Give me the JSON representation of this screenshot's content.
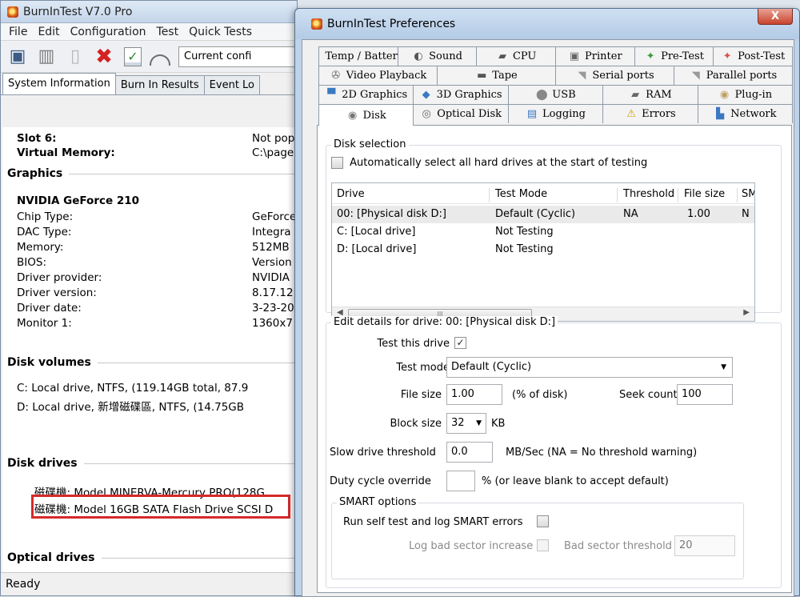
{
  "main": {
    "title": "BurnInTest V7.0 Pro",
    "menu": [
      "File",
      "Edit",
      "Configuration",
      "Test",
      "Quick Tests"
    ],
    "config_text": "Current confi",
    "tabs": [
      "System Information",
      "Burn In Results",
      "Event Lo"
    ],
    "status": "Ready",
    "info": {
      "slot6_label": "Slot 6:",
      "slot6_value": "Not pop",
      "vmem_label": "Virtual Memory:",
      "vmem_value": "C:\\page",
      "graphics_heading": "Graphics",
      "gpu_name": "NVIDIA GeForce 210",
      "graphics_rows": [
        {
          "label": "Chip Type:",
          "value": "GeForce"
        },
        {
          "label": "DAC Type:",
          "value": "Integra"
        },
        {
          "label": "Memory:",
          "value": "512MB"
        },
        {
          "label": "BIOS:",
          "value": "Version"
        },
        {
          "label": "Driver provider:",
          "value": "NVIDIA"
        },
        {
          "label": "Driver version:",
          "value": "8.17.12"
        },
        {
          "label": "Driver date:",
          "value": "3-23-20"
        },
        {
          "label": "Monitor 1:",
          "value": "1360x7"
        }
      ],
      "volumes_heading": "Disk volumes",
      "volumes": [
        "C:  Local drive, NTFS, (119.14GB total, 87.9",
        "D:  Local drive, 新增磁碟區, NTFS, (14.75GB"
      ],
      "drives_heading": "Disk drives",
      "drives": [
        "磁碟機: Model MINERVA-Mercury PRO(128G",
        "磁碟機: Model 16GB SATA Flash Drive SCSI D"
      ],
      "optical_heading": "Optical drives"
    }
  },
  "prefs": {
    "title": "BurnInTest Preferences",
    "close_label": "X",
    "tab_rows": [
      [
        {
          "label": "Temp / Battery",
          "icon": "thermometer-icon",
          "glyph": "▌",
          "color": "#d9534f"
        },
        {
          "label": "Sound",
          "icon": "speaker-icon",
          "glyph": "◐",
          "color": "#555555"
        },
        {
          "label": "CPU",
          "icon": "cpu-icon",
          "glyph": "▰",
          "color": "#555555"
        },
        {
          "label": "Printer",
          "icon": "printer-icon",
          "glyph": "▣",
          "color": "#666666"
        },
        {
          "label": "Pre-Test",
          "icon": "pretest-icon",
          "glyph": "✦",
          "color": "#3e9a3e"
        },
        {
          "label": "Post-Test",
          "icon": "posttest-icon",
          "glyph": "✦",
          "color": "#d9534f"
        }
      ],
      [
        {
          "label": "Video Playback",
          "icon": "video-icon",
          "glyph": "✇",
          "color": "#666666"
        },
        {
          "label": "Tape",
          "icon": "tape-icon",
          "glyph": "▬",
          "color": "#555555"
        },
        {
          "label": "Serial ports",
          "icon": "serial-port-icon",
          "glyph": "◥",
          "color": "#999999"
        },
        {
          "label": "Parallel ports",
          "icon": "parallel-port-icon",
          "glyph": "◥",
          "color": "#999999"
        }
      ],
      [
        {
          "label": "2D Graphics",
          "icon": "monitor-icon",
          "glyph": "▀",
          "color": "#3a78c2"
        },
        {
          "label": "3D Graphics",
          "icon": "cube-icon",
          "glyph": "◆",
          "color": "#3a78c2"
        },
        {
          "label": "USB",
          "icon": "usb-icon",
          "glyph": "⬤",
          "color": "#888888"
        },
        {
          "label": "RAM",
          "icon": "ram-icon",
          "glyph": "▰",
          "color": "#666666"
        },
        {
          "label": "Plug-in",
          "icon": "plugin-icon",
          "glyph": "◉",
          "color": "#c0a060"
        }
      ],
      [
        {
          "label": "Disk",
          "icon": "disk-icon",
          "glyph": "◉",
          "color": "#777777",
          "active": true
        },
        {
          "label": "Optical Disk",
          "icon": "optical-disk-icon",
          "glyph": "◎",
          "color": "#666666"
        },
        {
          "label": "Logging",
          "icon": "logging-icon",
          "glyph": "▤",
          "color": "#3a78c2"
        },
        {
          "label": "Errors",
          "icon": "warning-icon",
          "glyph": "⚠",
          "color": "#d4a000"
        },
        {
          "label": "Network",
          "icon": "network-icon",
          "glyph": "▙",
          "color": "#3a78c2"
        }
      ]
    ],
    "disk": {
      "selection_title": "Disk selection",
      "auto_select_label": "Automatically select all hard drives at the start of testing",
      "columns": [
        "Drive",
        "Test Mode",
        "Threshold",
        "File size",
        "SM"
      ],
      "rows": [
        {
          "drive": "00:  [Physical disk D:]",
          "mode": "Default (Cyclic)",
          "threshold": "NA",
          "filesize": "1.00",
          "smart": "N"
        },
        {
          "drive": "C:  [Local drive]",
          "mode": "Not Testing",
          "threshold": "",
          "filesize": "",
          "smart": ""
        },
        {
          "drive": "D:  [Local drive]",
          "mode": "Not Testing",
          "threshold": "",
          "filesize": "",
          "smart": ""
        }
      ],
      "scroll_grip": "III",
      "edit_title": "Edit details for drive: 00:  [Physical disk D:]",
      "test_drive_label": "Test this drive",
      "test_mode_label": "Test mode",
      "test_mode_value": "Default (Cyclic)",
      "file_size_label": "File size",
      "file_size_value": "1.00",
      "file_size_unit": "(% of disk)",
      "seek_label": "Seek count",
      "seek_value": "100",
      "block_label": "Block size",
      "block_value": "32",
      "block_unit": "KB",
      "slow_label": "Slow drive threshold",
      "slow_value": "0.0",
      "slow_unit": "MB/Sec  (NA = No threshold warning)",
      "duty_label": "Duty cycle override",
      "duty_value": "",
      "duty_unit": "% (or leave blank to accept default)",
      "smart_title": "SMART options",
      "smart_run_label": "Run self test and log SMART errors",
      "bad_increase_label": "Log bad sector increase",
      "bad_threshold_label": "Bad sector threshold",
      "bad_threshold_value": "20"
    }
  }
}
